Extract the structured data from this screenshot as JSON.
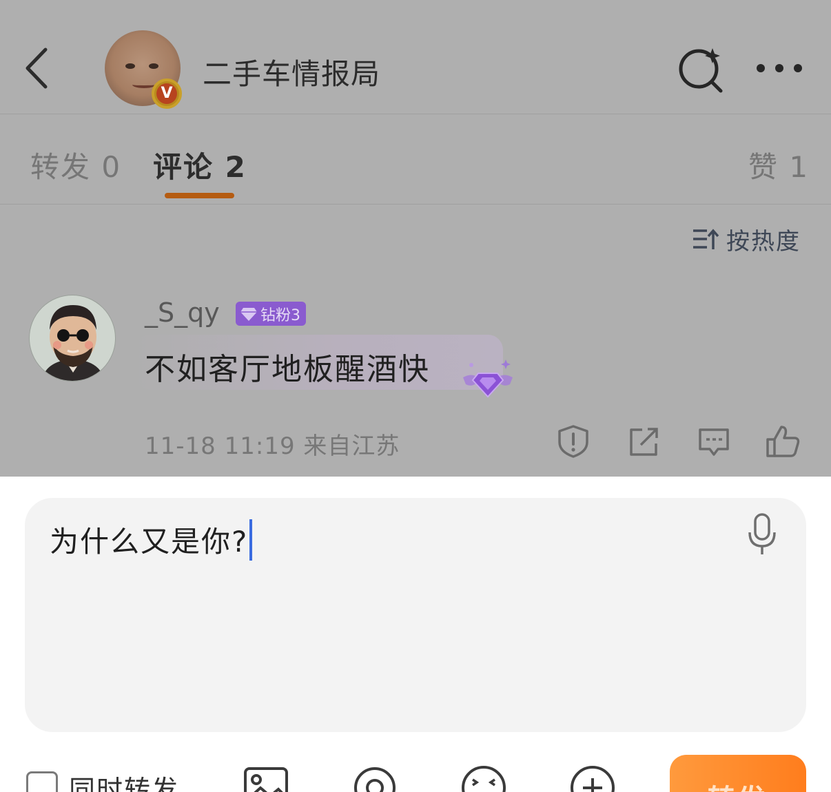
{
  "header": {
    "title": "二手车情报局",
    "verified_badge": "V",
    "icons": {
      "back": "chevron-left-icon",
      "search": "search-sparkle-icon",
      "more": "more-horizontal-icon"
    }
  },
  "tabs": [
    {
      "label": "转发 0",
      "active": false
    },
    {
      "label": "评论 2",
      "active": true
    },
    {
      "label": "赞 1",
      "active": false
    }
  ],
  "sort": {
    "label": "按热度",
    "icon": "sort-icon"
  },
  "comment": {
    "username": "_S_qy",
    "fan_badge": "钻粉3",
    "text": "不如客厅地板醒酒快",
    "meta": "11-18 11:19 来自江苏",
    "actions": [
      "report-icon",
      "share-icon",
      "reply-icon",
      "like-icon"
    ]
  },
  "composer": {
    "value": "为什么又是你?",
    "repost_label": "同时转发",
    "send_label": "转发",
    "tools": [
      "image-icon",
      "mention-icon",
      "emoji-icon",
      "plus-icon"
    ],
    "mic_icon": "microphone-icon"
  },
  "colors": {
    "accent": "#b55c12",
    "send_button": "#ff8a2a",
    "caret": "#3a6be0",
    "fan_badge": "#8a5bcf"
  }
}
